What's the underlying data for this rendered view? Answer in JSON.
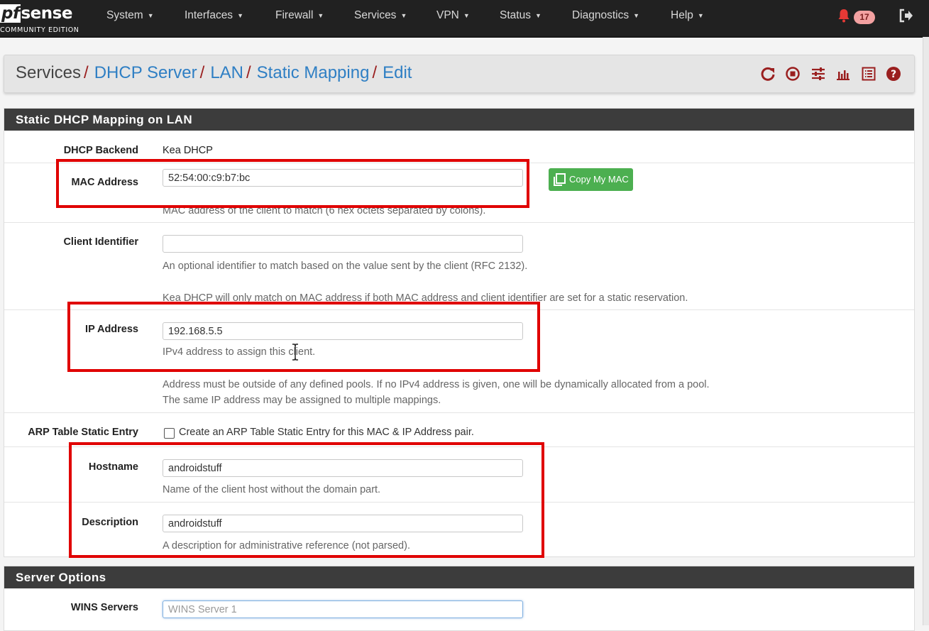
{
  "brand": {
    "pf": "pf",
    "name": "sense",
    "edition": "COMMUNITY EDITION"
  },
  "nav": {
    "items": [
      {
        "label": "System"
      },
      {
        "label": "Interfaces"
      },
      {
        "label": "Firewall"
      },
      {
        "label": "Services"
      },
      {
        "label": "VPN"
      },
      {
        "label": "Status"
      },
      {
        "label": "Diagnostics"
      },
      {
        "label": "Help"
      }
    ],
    "notification_count": "17",
    "icons": [
      "bell-icon",
      "logout-icon"
    ]
  },
  "breadcrumb": {
    "items": [
      "Services",
      "DHCP Server",
      "LAN",
      "Static Mapping",
      "Edit"
    ],
    "separator": "/",
    "icons": [
      "reload-icon",
      "stop-icon",
      "settings-sliders-icon",
      "chart-icon",
      "list-icon",
      "help-icon"
    ]
  },
  "colors": {
    "navbar": "#212121",
    "accent_red": "#9a1f1f",
    "link": "#2f7fc4",
    "panel_head": "#3c3c3c",
    "green": "#4caf50",
    "highlight": "#e00000"
  },
  "panel_mapping": {
    "title": "Static DHCP Mapping on LAN",
    "backend": {
      "label": "DHCP Backend",
      "value": "Kea DHCP"
    },
    "mac": {
      "label": "MAC Address",
      "value": "52:54:00:c9:b7:bc",
      "button": "Copy My MAC",
      "help": "MAC address of the client to match (6 hex octets separated by colons)."
    },
    "client_id": {
      "label": "Client Identifier",
      "value": "",
      "help1": "An optional identifier to match based on the value sent by the client (RFC 2132).",
      "help2": "Kea DHCP will only match on MAC address if both MAC address and client identifier are set for a static reservation."
    },
    "ip": {
      "label": "IP Address",
      "value": "192.168.5.5",
      "help1": "IPv4 address to assign this client.",
      "help2": "Address must be outside of any defined pools. If no IPv4 address is given, one will be dynamically allocated from a pool.",
      "help3": "The same IP address may be assigned to multiple mappings."
    },
    "arp": {
      "label": "ARP Table Static Entry",
      "checkbox_label": "Create an ARP Table Static Entry for this MAC & IP Address pair.",
      "checked": false
    },
    "hostname": {
      "label": "Hostname",
      "value": "androidstuff",
      "help": "Name of the client host without the domain part."
    },
    "description": {
      "label": "Description",
      "value": "androidstuff",
      "help": "A description for administrative reference (not parsed)."
    }
  },
  "panel_server": {
    "title": "Server Options",
    "wins": {
      "label": "WINS Servers",
      "placeholder": "WINS Server 1",
      "value": ""
    }
  }
}
